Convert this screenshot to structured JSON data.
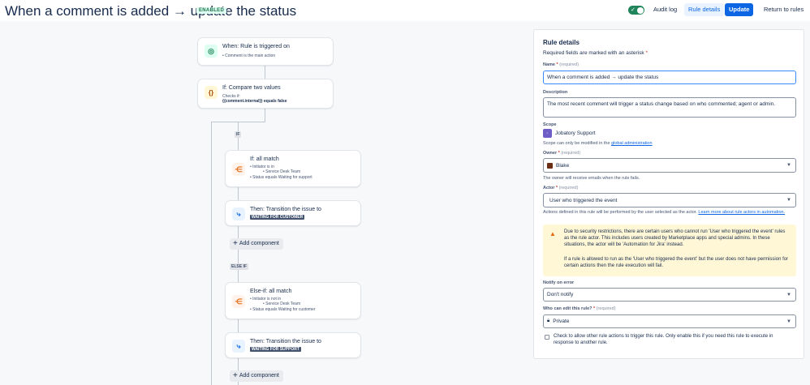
{
  "header": {
    "title": "When a comment is added → update the status",
    "status_badge": "ENABLED",
    "audit_log": "Audit log",
    "rule_details": "Rule details",
    "update": "Update",
    "return": "Return to rules"
  },
  "flow": {
    "trigger": {
      "title": "When: Rule is triggered on",
      "sub": "Comment is the main action"
    },
    "condition": {
      "title": "If: Compare two values",
      "sub1": "Checks if:",
      "sub2": "{{comment.internal}} equals false"
    },
    "branch_if": "IF",
    "branch_else_if": "ELSE IF",
    "if_match": {
      "title": "If: all match",
      "line1": "Initiator is in",
      "line2": "Service Desk Team",
      "line3": "Status equals Waiting for support"
    },
    "then1": {
      "title": "Then: Transition the issue to",
      "lozenge": "WAITING FOR CUSTOMER"
    },
    "add_component_1": "Add component",
    "else_match": {
      "title": "Else-if: all match",
      "line1": "Initiator is not in",
      "line2": "Service Desk Team",
      "line3": "Status equals Waiting for customer"
    },
    "then2": {
      "title": "Then: Transition the issue to",
      "lozenge": "WAITING FOR SUPPORT"
    },
    "add_component_2": "Add component"
  },
  "panel": {
    "heading": "Rule details",
    "required_note": "Required fields are marked with an asterisk",
    "asterisk": "*",
    "name_label": "Name",
    "required_hint": "(required)",
    "name_value": "When a comment is added → update the status",
    "description_label": "Description",
    "description_value": "The most recent comment will trigger a status change based on who commented; agent or admin.",
    "scope_label": "Scope",
    "scope_value": "Jobatory Support",
    "scope_help": "Scope can only be modified in the",
    "scope_link": "global administration",
    "owner_label": "Owner",
    "owner_value": "Blake",
    "owner_help": "The owner will receive emails when the rule fails.",
    "actor_label": "Actor",
    "actor_value": "User who triggered the event",
    "actor_help": "Actions defined in this rule will be performed by the user selected as the actor.",
    "actor_link": "Learn more about rule actors in automation.",
    "warning_p1": "Due to security restrictions, there are certain users who cannot run 'User who triggered the event' rules as the rule actor. This includes users created by Marketplace apps and special admins. In these situations, the actor will be 'Automation for Jira' instead.",
    "warning_p2": "If a rule is allowed to run as the 'User who triggered the event' but the user does not have permission for certain actions then the rule execution will fail.",
    "notify_label": "Notify on error",
    "notify_value": "Don't notify",
    "edit_label": "Who can edit this rule?",
    "edit_value": "Private",
    "checkbox_text": "Check to allow other rule actions to trigger this rule. Only enable this if you need this rule to execute in response to another rule."
  }
}
